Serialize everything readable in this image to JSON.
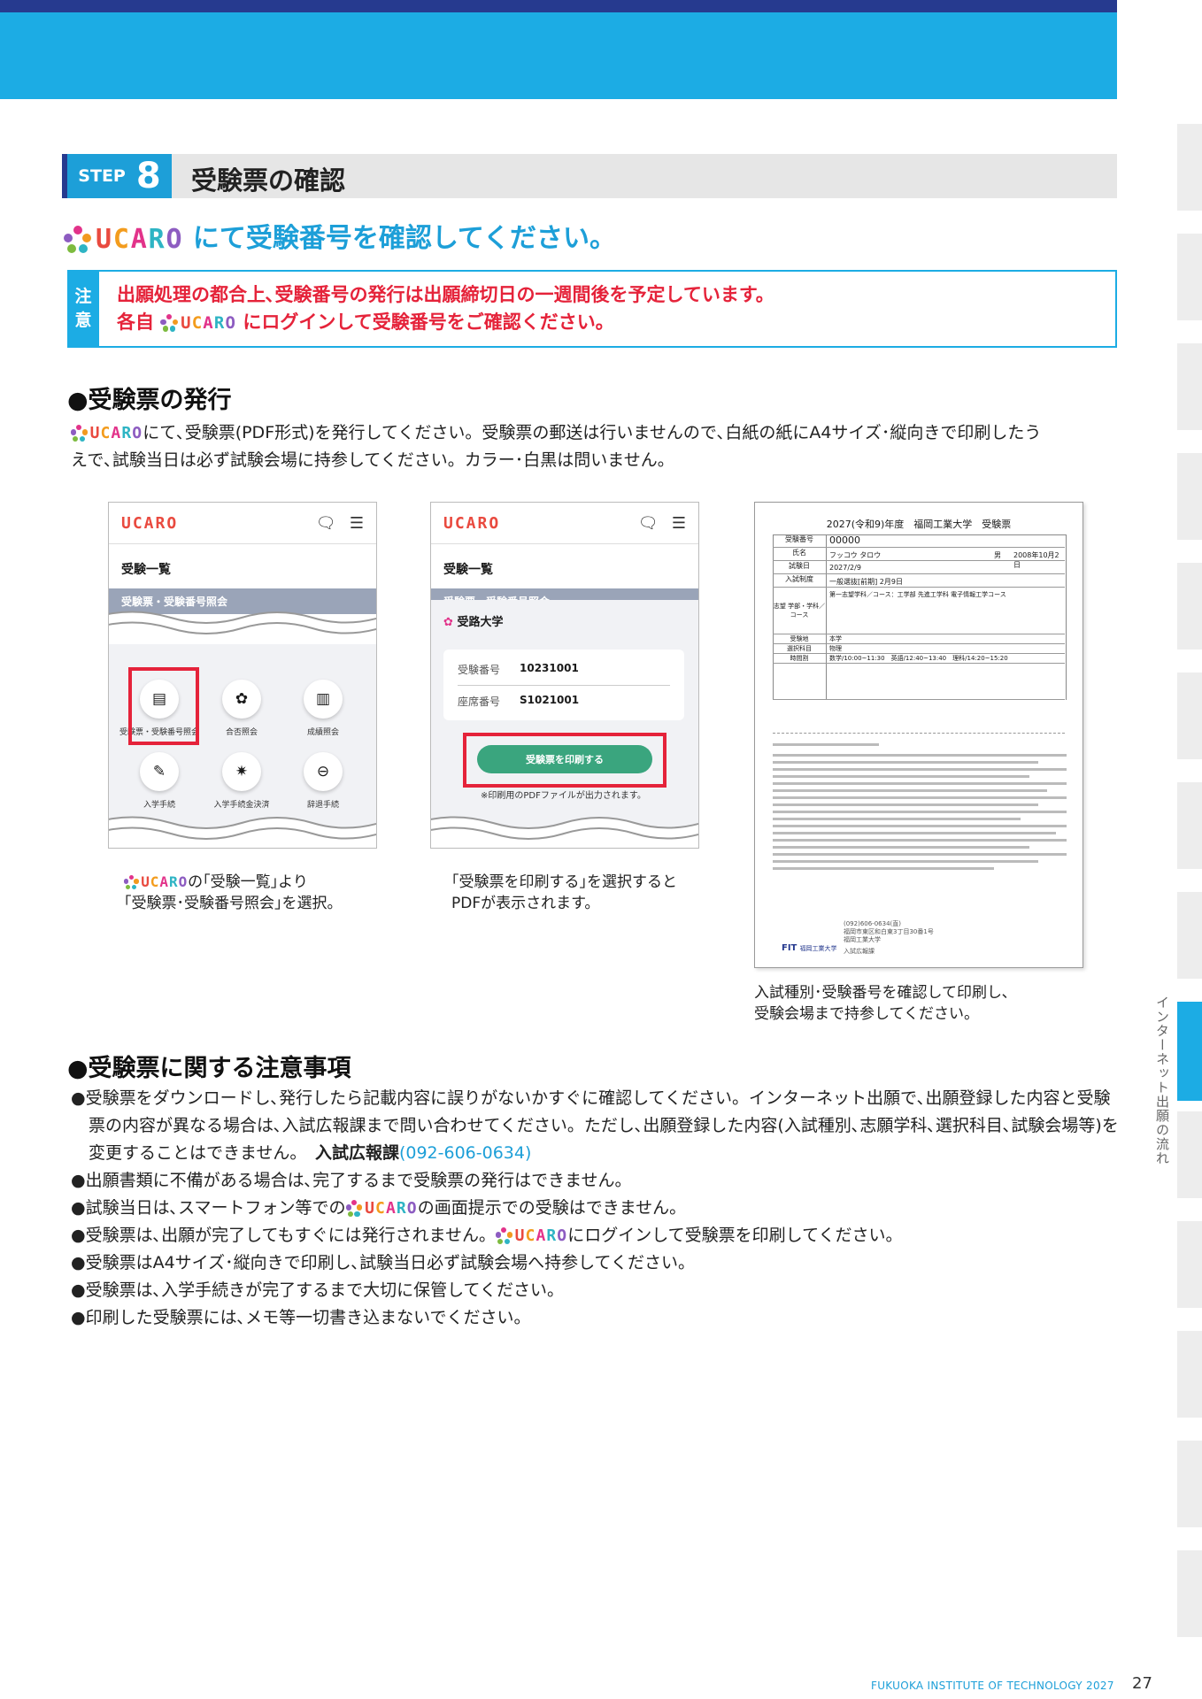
{
  "step": {
    "word": "STEP",
    "number": "8",
    "title": "受験票の確認"
  },
  "headline": {
    "logo": "UCARO",
    "text": "にて受験番号を確認してください。"
  },
  "note": {
    "side": [
      "注",
      "意"
    ],
    "line1": "出願処理の都合上､受験番号の発行は出願締切日の一週間後を予定しています。",
    "line2_prefix": "各自",
    "line2_logo": "UCARO",
    "line2_suffix": "にログインして受験番号をご確認ください。"
  },
  "issue": {
    "heading": "●受験票の発行",
    "logo": "UCARO",
    "body_line1": "にて､受験票(PDF形式)を発行してください。受験票の郵送は行いませんので､白紙の紙にA4サイズ･縦向きで印刷したう",
    "body_line2": "えで､試験当日は必ず試験会場に持参してください。カラー･白黒は問いません。"
  },
  "phone1": {
    "logo": "UCARO",
    "list_title": "受験一覧",
    "gray_bar": "受験票・受験番号照会",
    "icons": [
      {
        "icon": "document-icon",
        "label": "受験票・受験番号照会"
      },
      {
        "icon": "flower-icon",
        "label": "合否照会"
      },
      {
        "icon": "bar-chart-icon",
        "label": "成績照会"
      },
      {
        "icon": "pencil-icon",
        "label": "入学手続"
      },
      {
        "icon": "gear-icon",
        "label": "入学手続金決済"
      },
      {
        "icon": "minus-circle-icon",
        "label": "辞退手続"
      }
    ],
    "caption_logo": "UCARO",
    "caption_line1": "の｢受験一覧｣より",
    "caption_line2": "｢受験票･受験番号照会｣を選択。"
  },
  "phone2": {
    "logo": "UCARO",
    "list_title": "受験一覧",
    "gray_bar": "受験票・受験番号照会",
    "university": "受路大学",
    "exam_no_label": "受験番号",
    "exam_no": "10231001",
    "seat_no_label": "座席番号",
    "seat_no": "S1021001",
    "print_button": "受験票を印刷する",
    "print_note": "※印刷用のPDFファイルが出力されます。",
    "caption_line1": "｢受験票を印刷する｣を選択すると",
    "caption_line2": "PDFが表示されます。"
  },
  "ticket": {
    "title": "2027(令和9)年度　福岡工業大学　受験票",
    "rows": [
      {
        "label": "受験番号",
        "value": "00000"
      },
      {
        "label": "氏名",
        "value": "フッコウ タロウ"
      },
      {
        "label": "試験日",
        "value": "2027/2/9"
      },
      {
        "label": "入試制度",
        "value": "一般選抜[前期] 2月9日"
      },
      {
        "label": "志望 学部・学科／コース",
        "value": "第一志望学科／コース：工学部 先進工学科 電子情報工学コース"
      },
      {
        "label": "受験地",
        "value": "本学"
      },
      {
        "label": "選択科目",
        "value": "物理"
      },
      {
        "label": "時間割",
        "value": "数学/10:00~11:30　英語/12:40~13:40　理科/14:20~15:20"
      }
    ],
    "gender": "男",
    "birth": "2008年10月2日",
    "contact_phone": "(092)606-0634(直)",
    "contact_address": "福岡市東区和白東3丁目30番1号",
    "contact_org": "福岡工業大学",
    "contact_dept": "入試広報課",
    "logo": "FIT",
    "logo_name": "福岡工業大学",
    "caption_line1": "入試種別･受験番号を確認して印刷し､",
    "caption_line2": "受験会場まで持参してください。"
  },
  "notices": {
    "heading": "●受験票に関する注意事項",
    "item1": "受験票をダウンロードし､発行したら記載内容に誤りがないかすぐに確認してください。インターネット出願で､出願登録した内容と受験票の内容が異なる場合は､入試広報課まで問い合わせてください。ただし､出願登録した内容(入試種別､志願学科､選択科目､試験会場等)を変更することはできません。　",
    "item1_office": "入試広報課",
    "item1_phone": "(092-606-0634)",
    "item2": "出願書類に不備がある場合は､完了するまで受験票の発行はできません。",
    "item3_prefix": "試験当日は､スマートフォン等での",
    "item3_logo": "UCARO",
    "item3_suffix": "の画面提示での受験はできません。",
    "item4_prefix": "受験票は､出願が完了してもすぐには発行されません。",
    "item4_logo": "UCARO",
    "item4_suffix": "にログインして受験票を印刷してください。",
    "item5": "受験票はA4サイズ･縦向きで印刷し､試験当日必ず試験会場へ持参してください。",
    "item6": "受験票は､入学手続きが完了するまで大切に保管してください。",
    "item7": "印刷した受験票には､メモ等一切書き込まないでください。"
  },
  "side_label": "インターネット出願の流れ",
  "footer": {
    "text": "FUKUOKA INSTITUTE OF TECHNOLOGY 2027",
    "page": "27"
  },
  "colors": {
    "brand_blue": "#1cace4",
    "navy": "#263a8f",
    "alert_red": "#e5233a",
    "button_green": "#3aa57e"
  }
}
